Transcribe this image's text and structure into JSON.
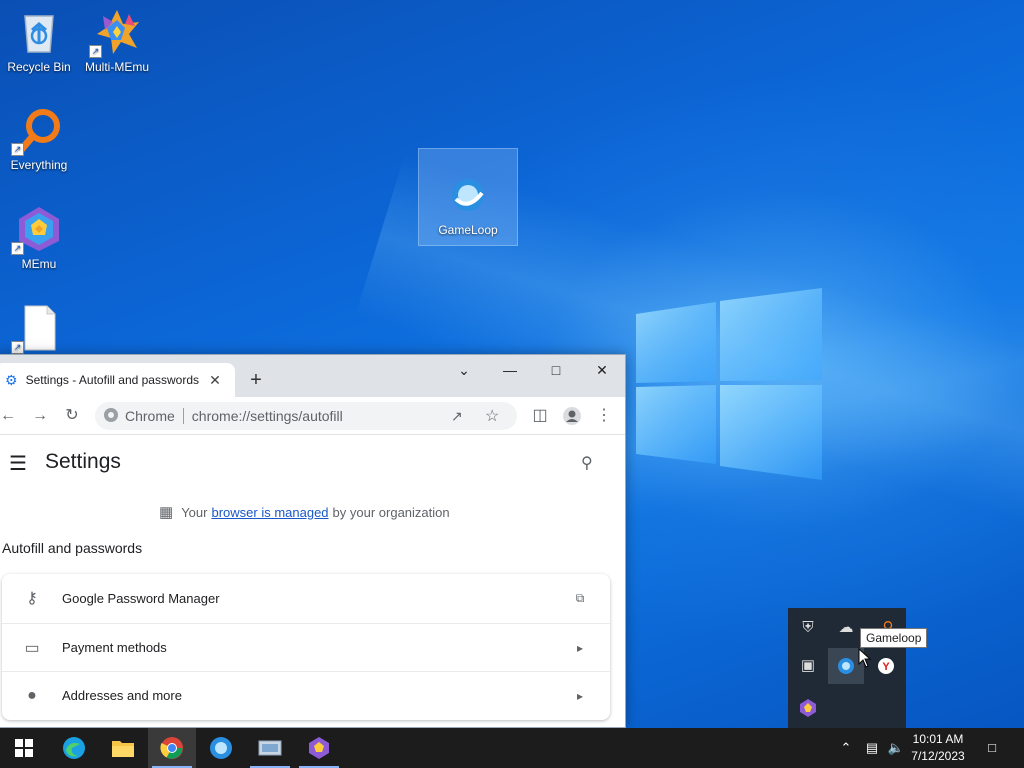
{
  "desktop": {
    "icons": [
      {
        "label": "Recycle Bin",
        "icon": "recycle-bin-icon"
      },
      {
        "label": "Multi-MEmu",
        "icon": "multi-memu-icon"
      },
      {
        "label": "Everything",
        "icon": "everything-search-icon"
      },
      {
        "label": "MEmu",
        "icon": "memu-icon"
      },
      {
        "label": "",
        "icon": "blank-file-icon"
      },
      {
        "label": "GameLoop",
        "icon": "gameloop-icon"
      }
    ]
  },
  "chrome": {
    "tab": {
      "title": "Settings - Autofill and passwords",
      "icon": "gear-icon"
    },
    "omnibox": {
      "site": "Chrome",
      "url": "chrome://settings/autofill"
    },
    "settings": {
      "title": "Settings",
      "managed": {
        "prefix": "Your",
        "link": "browser is managed",
        "suffix": "by your organization"
      },
      "section_title": "Autofill and passwords",
      "rows": [
        {
          "label": "Google Password Manager",
          "icon": "key-icon",
          "trail": "open-external-icon"
        },
        {
          "label": "Payment methods",
          "icon": "credit-card-icon",
          "trail": "arrow-right-icon"
        },
        {
          "label": "Addresses and more",
          "icon": "location-pin-icon",
          "trail": "arrow-right-icon"
        }
      ]
    }
  },
  "tray": {
    "tooltip": "Gameloop"
  },
  "taskbar": {
    "apps": [
      "start-icon",
      "edge-icon",
      "file-explorer-icon",
      "chrome-icon",
      "gameloop-icon",
      "multi-memu-icon",
      "memu-icon"
    ],
    "clock": {
      "time": "10:01 AM",
      "date": "7/12/2023"
    }
  },
  "colors": {
    "accent": "#1a57c8",
    "taskbar": "#1c1c1c",
    "wallpaper": "#0c66d6"
  }
}
